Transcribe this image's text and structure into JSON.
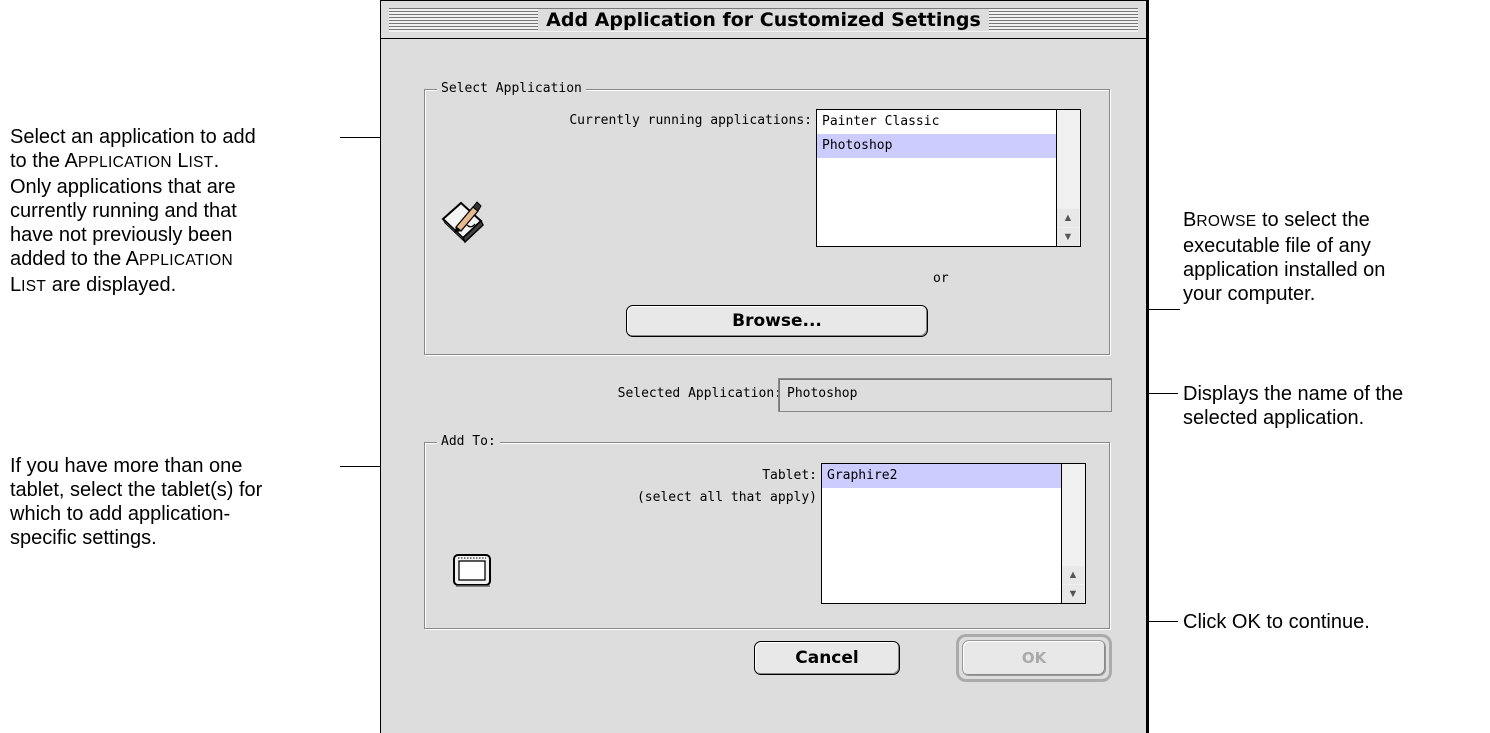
{
  "dialog": {
    "title": "Add Application for Customized Settings",
    "select_group": {
      "label": "Select Application",
      "running_label": "Currently running applications:",
      "running_apps": [
        "Painter Classic",
        "Photoshop"
      ],
      "selected_index": 1,
      "or_text": "or",
      "browse_label": "Browse..."
    },
    "selected_app": {
      "label": "Selected Application:",
      "value": "Photoshop"
    },
    "add_to_group": {
      "label": "Add To:",
      "tablet_label": "Tablet:",
      "tablet_hint": "(select all that apply)",
      "tablets": [
        "Graphire2"
      ]
    },
    "cancel_label": "Cancel",
    "ok_label": "OK"
  },
  "annotations": {
    "select_app": {
      "l1": "Select an application to add",
      "l2_pre": "to the ",
      "l2_a": "A",
      "l2_b": "PPLICATION",
      "l2_c": " L",
      "l2_d": "IST",
      "l2_post": ".",
      "l3": "Only applications that are",
      "l4": "currently running and that",
      "l5": "have not previously been",
      "l6_pre": "added to the ",
      "l6_a": "A",
      "l6_b": "PPLICATION",
      "l7_a": "L",
      "l7_b": "IST",
      "l7_post": " are displayed."
    },
    "browse": {
      "l1_a": "B",
      "l1_b": "ROWSE",
      "l1_post": " to select the",
      "l2": "executable file of any",
      "l3": "application installed on",
      "l4": "your computer."
    },
    "selected": {
      "l1": "Displays the name of the",
      "l2": "selected application."
    },
    "tablet": {
      "l1": "If you have more than one",
      "l2": "tablet, select the tablet(s) for",
      "l3": "which to add application-",
      "l4": "specific settings."
    },
    "ok": {
      "l1": "Click OK to continue."
    }
  }
}
